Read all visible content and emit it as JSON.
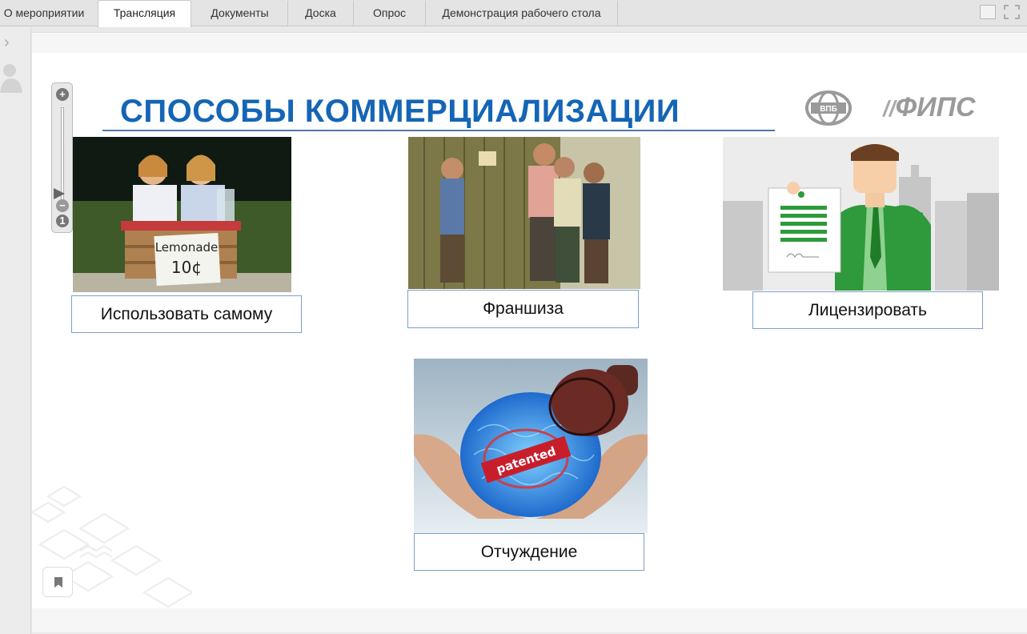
{
  "tabs": [
    {
      "label": "О мероприятии",
      "active": false
    },
    {
      "label": "Трансляция",
      "active": true
    },
    {
      "label": "Документы",
      "active": false
    },
    {
      "label": "Доска",
      "active": false
    },
    {
      "label": "Опрос",
      "active": false
    },
    {
      "label": "Демонстрация рабочего стола",
      "active": false
    }
  ],
  "slide": {
    "title": "СПОСОБЫ КОММЕРЦИАЛИЗАЦИИ",
    "logo_text": "ФИПС",
    "logo_vpb_text": "ВПБ",
    "items": [
      {
        "caption": "Использовать самому",
        "sign_line1": "Lemonade",
        "sign_line2": "10¢"
      },
      {
        "caption": "Франшиза"
      },
      {
        "caption": "Лицензировать"
      },
      {
        "caption": "Отчуждение",
        "stamp_text": "patented"
      }
    ]
  },
  "zoom": {
    "plus_label": "+",
    "minus_label": "−",
    "reset_label": "1"
  },
  "colors": {
    "title": "#1565b5",
    "caption_border": "#7aa0cc",
    "license_green": "#2e9a3c"
  }
}
